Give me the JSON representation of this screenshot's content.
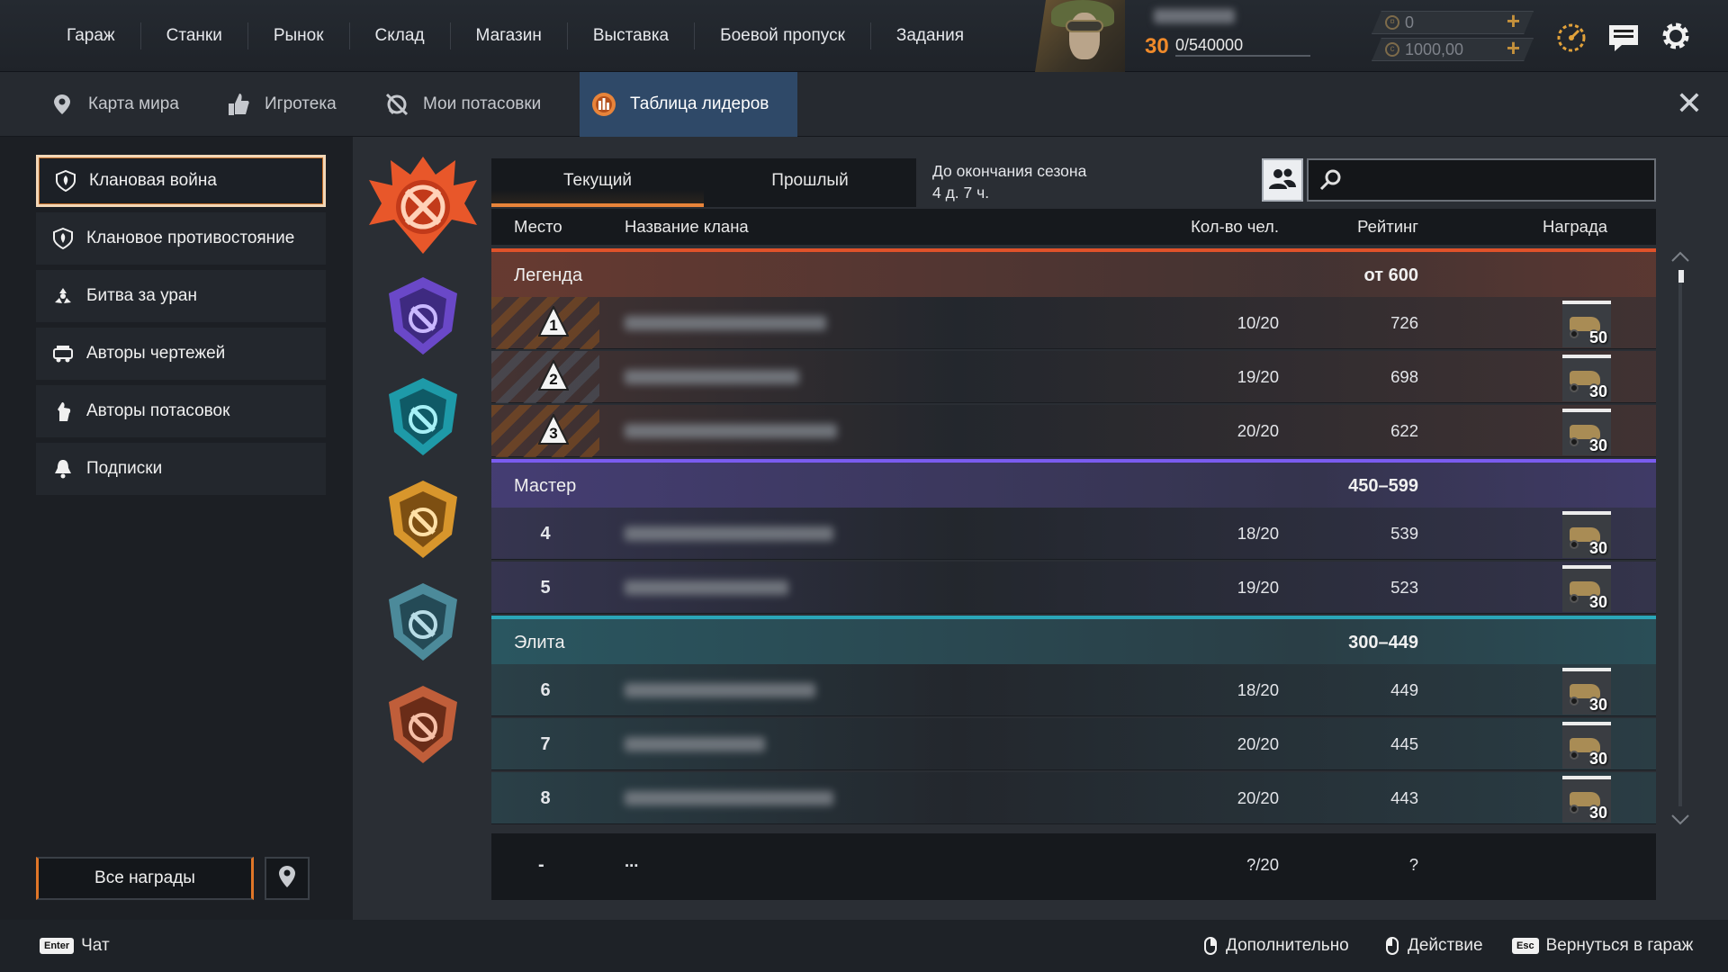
{
  "nav": {
    "items": [
      "Гараж",
      "Станки",
      "Рынок",
      "Склад",
      "Магазин",
      "Выставка",
      "Боевой пропуск",
      "Задания"
    ]
  },
  "player": {
    "level": "30",
    "xp": "0/540000"
  },
  "currency": {
    "gold": "0",
    "coins": "1000,00"
  },
  "subtabs": [
    {
      "label": "Карта мира",
      "icon": "map-pin-icon"
    },
    {
      "label": "Игротека",
      "icon": "thumbs-up-icon"
    },
    {
      "label": "Мои потасовки",
      "icon": "brawl-icon"
    },
    {
      "label": "Таблица лидеров",
      "icon": "leaderboard-icon",
      "active": true
    }
  ],
  "sidebar": {
    "items": [
      {
        "label": "Клановая война",
        "icon": "clan-war-icon",
        "active": true
      },
      {
        "label": "Клановое противостояние",
        "icon": "clan-confrontation-icon"
      },
      {
        "label": "Битва за уран",
        "icon": "uranium-battle-icon"
      },
      {
        "label": "Авторы чертежей",
        "icon": "blueprint-authors-icon"
      },
      {
        "label": "Авторы потасовок",
        "icon": "brawl-authors-icon"
      },
      {
        "label": "Подписки",
        "icon": "bell-icon"
      }
    ],
    "all_rewards": "Все награды"
  },
  "period_tabs": {
    "current": "Текущий",
    "past": "Прошлый"
  },
  "season": {
    "line1": "До окончания сезона",
    "line2": "4 д. 7 ч."
  },
  "table": {
    "headers": {
      "place": "Место",
      "clan": "Название клана",
      "members": "Кол-во чел.",
      "rating": "Рейтинг",
      "reward": "Награда"
    },
    "groups": [
      {
        "name": "Легенда",
        "range": "от 600",
        "color": "#e0522a",
        "rows": [
          {
            "place": "1",
            "members": "10/20",
            "rating": "726",
            "reward": "50"
          },
          {
            "place": "2",
            "members": "19/20",
            "rating": "698",
            "reward": "30"
          },
          {
            "place": "3",
            "members": "20/20",
            "rating": "622",
            "reward": "30"
          }
        ]
      },
      {
        "name": "Мастер",
        "range": "450–599",
        "color": "#7a5cf0",
        "rows": [
          {
            "place": "4",
            "members": "18/20",
            "rating": "539",
            "reward": "30"
          },
          {
            "place": "5",
            "members": "19/20",
            "rating": "523",
            "reward": "30"
          }
        ]
      },
      {
        "name": "Элита",
        "range": "300–449",
        "color": "#2aa6b8",
        "rows": [
          {
            "place": "6",
            "members": "18/20",
            "rating": "449",
            "reward": "30"
          },
          {
            "place": "7",
            "members": "20/20",
            "rating": "445",
            "reward": "30"
          },
          {
            "place": "8",
            "members": "20/20",
            "rating": "443",
            "reward": "30"
          }
        ]
      }
    ],
    "self_row": {
      "place": "-",
      "clan": "...",
      "members": "?/20",
      "rating": "?"
    }
  },
  "footer": {
    "chat_key": "Enter",
    "chat": "Чат",
    "more": "Дополнительно",
    "action": "Действие",
    "back_key": "Esc",
    "back": "Вернуться в гараж"
  }
}
